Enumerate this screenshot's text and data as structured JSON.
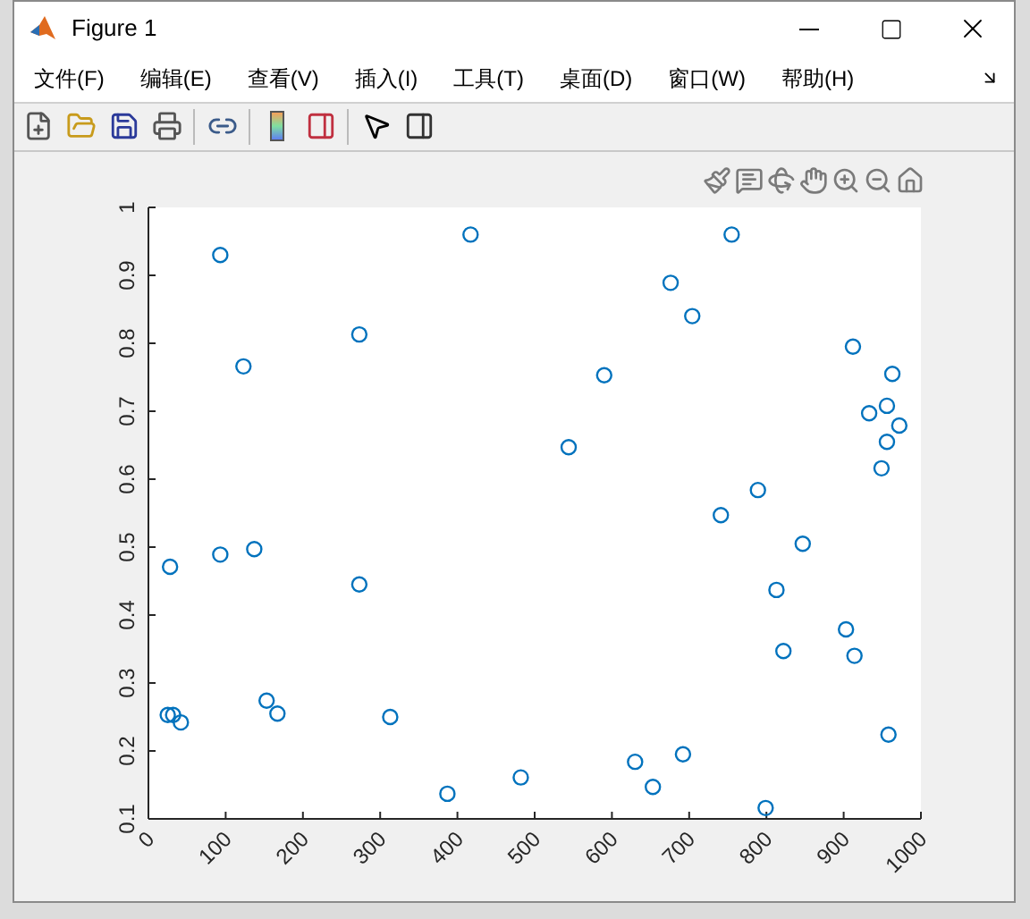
{
  "window": {
    "title": "Figure 1"
  },
  "menu": [
    "文件(F)",
    "编辑(E)",
    "查看(V)",
    "插入(I)",
    "工具(T)",
    "桌面(D)",
    "窗口(W)",
    "帮助(H)"
  ],
  "chart_data": {
    "type": "scatter",
    "xlim": [
      0,
      1000
    ],
    "ylim": [
      0.1,
      1
    ],
    "xticks": [
      0,
      100,
      200,
      300,
      400,
      500,
      600,
      700,
      800,
      900,
      1000
    ],
    "yticks": [
      0.1,
      0.2,
      0.3,
      0.4,
      0.5,
      0.6,
      0.7,
      0.8,
      0.9,
      1
    ],
    "series": [
      {
        "color": "#0072bd",
        "x": [
          93,
          417,
          755,
          273,
          123,
          676,
          704,
          912,
          590,
          963,
          956,
          933,
          972,
          956,
          949,
          544,
          789,
          741,
          847,
          137,
          93,
          28,
          273,
          813,
          903,
          822,
          914,
          153,
          167,
          25,
          32,
          42,
          313,
          387,
          482,
          630,
          692,
          653,
          958,
          799
        ],
        "values": [
          0.93,
          0.96,
          0.96,
          0.813,
          0.766,
          0.889,
          0.84,
          0.795,
          0.753,
          0.755,
          0.708,
          0.697,
          0.679,
          0.655,
          0.616,
          0.647,
          0.584,
          0.547,
          0.505,
          0.497,
          0.489,
          0.471,
          0.445,
          0.437,
          0.379,
          0.347,
          0.34,
          0.274,
          0.255,
          0.253,
          0.253,
          0.242,
          0.25,
          0.137,
          0.161,
          0.184,
          0.195,
          0.147,
          0.224,
          0.116
        ]
      }
    ]
  }
}
